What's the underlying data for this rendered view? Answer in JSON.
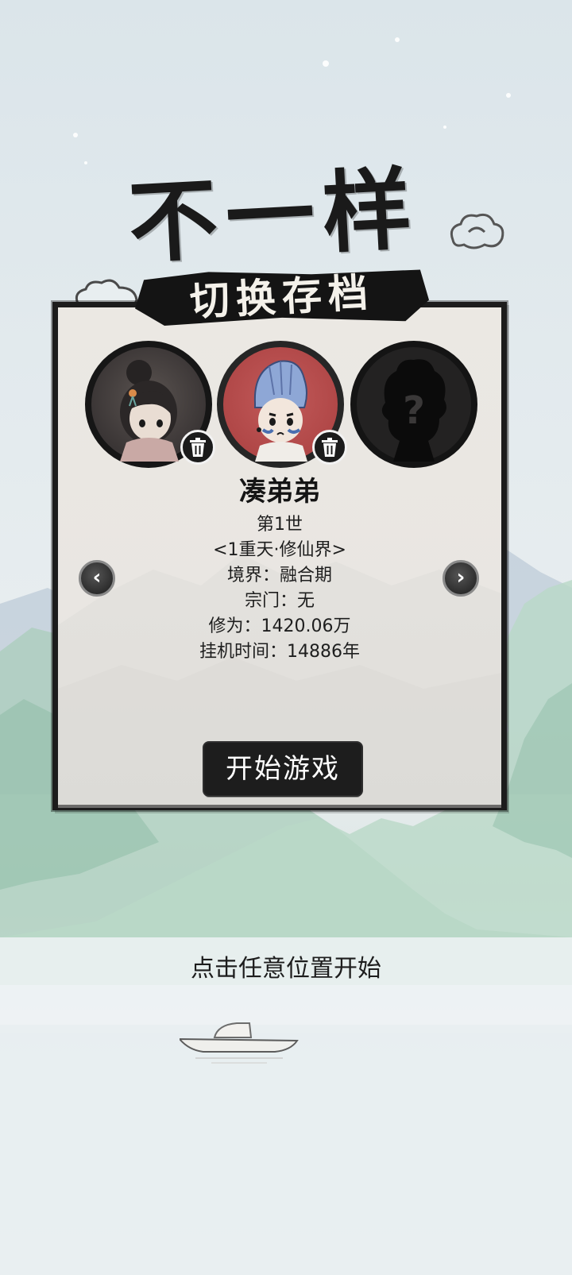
{
  "title": {
    "text": "不一样"
  },
  "panel": {
    "banner": "切换存档",
    "slots": [
      {
        "name": "female-cultivator-avatar",
        "type": "character",
        "has_delete": true
      },
      {
        "name": "blue-haired-boy-avatar",
        "type": "character",
        "selected": true,
        "has_delete": true
      },
      {
        "name": "locked-slot",
        "type": "unknown",
        "symbol": "?"
      }
    ],
    "character": {
      "name": "凑弟弟",
      "generation": "第1世",
      "realm": "<1重天·修仙界>",
      "stage": "境界：融合期",
      "sect": "宗门：无",
      "cultivation": "修为：1420.06万",
      "idle_time": "挂机时间：14886年"
    },
    "arrows": {
      "left": "‹",
      "right": "›"
    },
    "start_button": "开始游戏"
  },
  "hint": "点击任意位置开始",
  "colors": {
    "ink": "#1a1a1a",
    "panel_bg": "#ebe8e3",
    "selected_slot": "#b04747",
    "sky": "#dbe5ea",
    "mountain": "#9fc7b5"
  }
}
